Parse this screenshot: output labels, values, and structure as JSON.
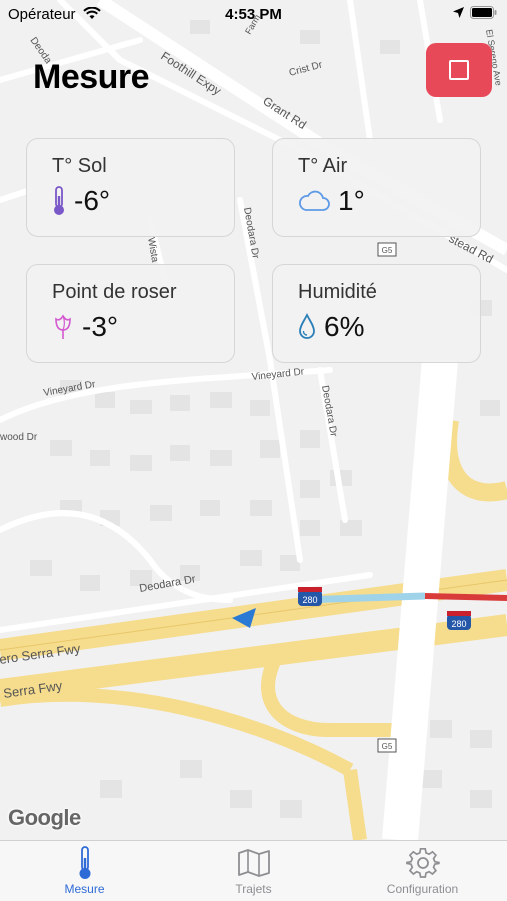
{
  "status_bar": {
    "carrier": "Opérateur",
    "time": "4:53 PM"
  },
  "header": {
    "title": "Mesure"
  },
  "cards": [
    {
      "label": "T° Sol",
      "value": "-6°",
      "icon": "thermometer-icon"
    },
    {
      "label": "T° Air",
      "value": "1°",
      "icon": "cloud-icon"
    },
    {
      "label": "Point de roser",
      "value": "-3°",
      "icon": "flower-icon"
    },
    {
      "label": "Humidité",
      "value": "6%",
      "icon": "drop-icon"
    }
  ],
  "map": {
    "attribution": "Google",
    "streets": {
      "foothill": "Foothill Expy",
      "grant": "Grant Rd",
      "crist": "Crist Dr",
      "deodara1": "Deodara Dr",
      "deodara2": "Deodara Dr",
      "deodara3": "Deodara Dr",
      "vineyard1": "Vineyard Dr",
      "vineyard2": "Vineyard Dr",
      "stead": "stead Rd",
      "serra1": "ero Serra Fwy",
      "serra2": "Serra Fwy",
      "wood1": "wood I",
      "wood2": "wood Dr",
      "wista": "Wista",
      "farm": "Farm",
      "el_sereno": "El Sereno Ave",
      "deoda": "Deoda",
      "shield_280": "280",
      "shield_g5": "G5"
    }
  },
  "tabs": [
    {
      "label": "Mesure",
      "icon": "thermometer-icon",
      "active": true
    },
    {
      "label": "Trajets",
      "icon": "map-icon",
      "active": false
    },
    {
      "label": "Configuration",
      "icon": "gear-icon",
      "active": false
    }
  ],
  "colors": {
    "accent": "#2f6bd6",
    "stop": "#e84958",
    "highway": "#f6dc8d",
    "traffic_red": "#d93b3b",
    "traffic_blue": "#9fd3ea"
  }
}
